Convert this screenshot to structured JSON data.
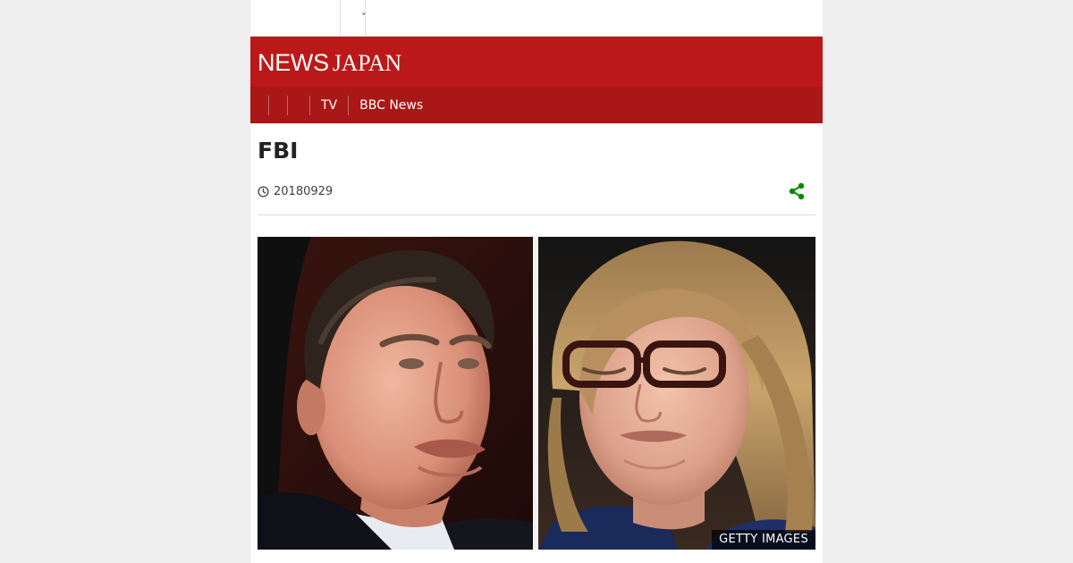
{
  "topbar": {
    "chevron": "ˇ",
    "icons": [
      "chevron-down-icon"
    ]
  },
  "masthead": {
    "brand_news": "NEWS",
    "brand_region": "JAPAN",
    "background": "#bb1919"
  },
  "nav": {
    "items": [
      "TV",
      "BBC News"
    ]
  },
  "article": {
    "headline": "FBI",
    "date": "20180929",
    "image_credit": "GETTY IMAGES"
  },
  "colors": {
    "accent": "#bb1919",
    "nav": "#a91717",
    "share": "#008a00",
    "text": "#222222"
  }
}
